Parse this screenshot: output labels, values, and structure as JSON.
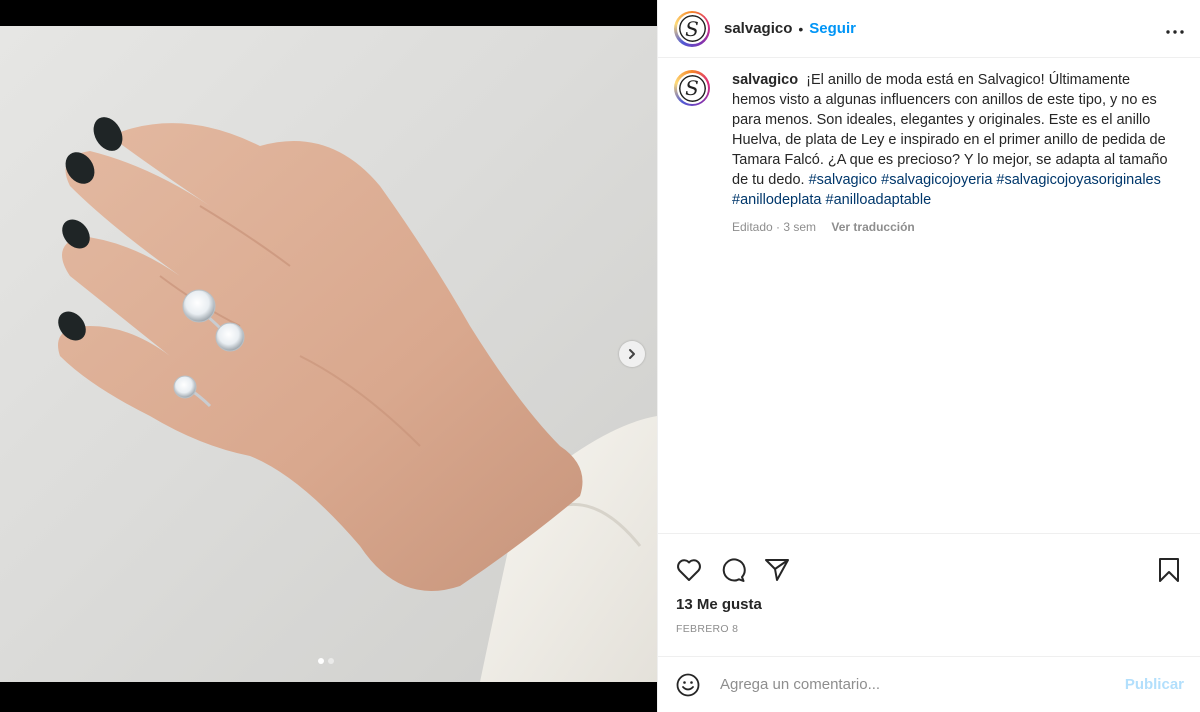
{
  "post": {
    "username": "salvagico",
    "separator": "•",
    "follow_label": "Seguir",
    "more_label": "•••",
    "avatar_letter": "S"
  },
  "caption": {
    "username": "salvagico",
    "text": "¡El anillo de moda está en Salvagico! Últimamente hemos visto a algunas influencers con anillos de este tipo, y no es para menos. Son ideales, elegantes y originales. Este es el anillo Huelva, de plata de Ley e inspirado en el primer anillo de pedida de Tamara Falcó. ¿A que es precioso? Y lo mejor, se adapta al tamaño de tu dedo.",
    "hashtags": [
      "#salvagico",
      "#salvagicojoyeria",
      "#salvagicojoyasoriginales",
      "#anillodeplata",
      "#anilloadaptable"
    ],
    "edited": "Editado · 3 sem",
    "translate_label": "Ver traducción"
  },
  "actions": {
    "like_icon": "heart-icon",
    "comment_icon": "comment-icon",
    "share_icon": "paper-plane-icon",
    "save_icon": "bookmark-icon"
  },
  "likes_text": "13 Me gusta",
  "date_text": "FEBRERO 8",
  "comment": {
    "placeholder": "Agrega un comentario...",
    "publish_label": "Publicar"
  },
  "carousel": {
    "total_slides": 2,
    "current_slide": 1
  },
  "colors": {
    "link_blue": "#0095f6",
    "hashtag": "#00376b",
    "publish_disabled": "#b2dffc",
    "secondary_text": "#8e8e8e"
  }
}
